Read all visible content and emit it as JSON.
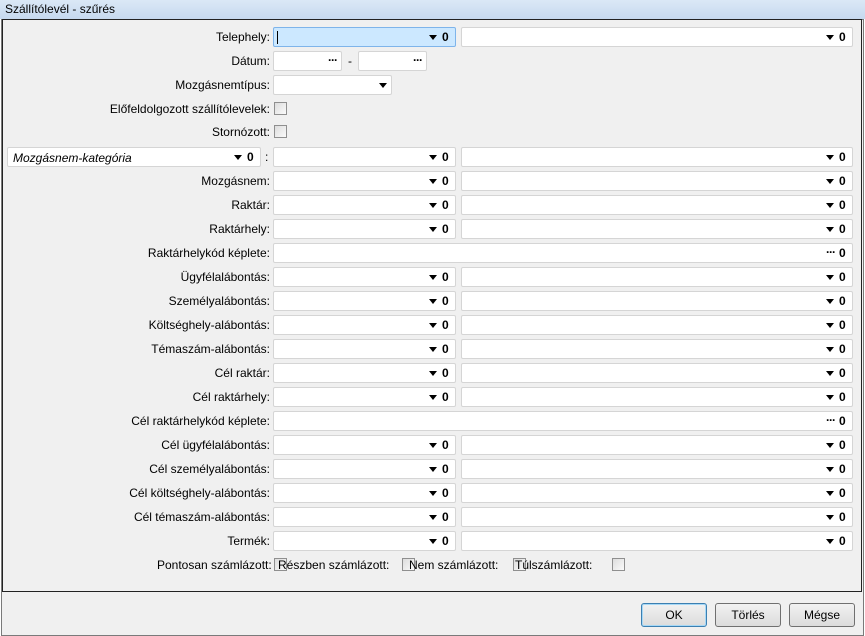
{
  "window": {
    "title": "Szállítólevél - szűrés"
  },
  "form": {
    "telephely": "Telephely:",
    "datum": "Dátum:",
    "datum_sep": "-",
    "mozgasnemtipus": "Mozgásnemtípus:",
    "elofeldolgozott": "Előfeldolgozott szállítólevelek:",
    "stornozott": "Stornózott:",
    "kategoria_select": "Mozgásnem-kategória",
    "kategoria_sep": ":",
    "pair_rows": [
      {
        "label": "Mozgásnem:",
        "type": "pair"
      },
      {
        "label": "Raktár:",
        "type": "pair"
      },
      {
        "label": "Raktárhely:",
        "type": "pair"
      },
      {
        "label": "Raktárhelykód képlete:",
        "type": "formula"
      },
      {
        "label": "Ügyfélalábontás:",
        "type": "pair"
      },
      {
        "label": "Személyalábontás:",
        "type": "pair"
      },
      {
        "label": "Költséghely-alábontás:",
        "type": "pair"
      },
      {
        "label": "Témaszám-alábontás:",
        "type": "pair"
      },
      {
        "label": "Cél raktár:",
        "type": "pair"
      },
      {
        "label": "Cél raktárhely:",
        "type": "pair"
      },
      {
        "label": "Cél raktárhelykód képlete:",
        "type": "formula"
      },
      {
        "label": "Cél ügyfélalábontás:",
        "type": "pair"
      },
      {
        "label": "Cél személyalábontás:",
        "type": "pair"
      },
      {
        "label": "Cél költséghely-alábontás:",
        "type": "pair"
      },
      {
        "label": "Cél témaszám-alábontás:",
        "type": "pair"
      },
      {
        "label": "Termék:",
        "type": "pair"
      }
    ],
    "invoice": [
      "Pontosan számlázott:",
      "Részben számlázott:",
      "Nem számlázott:",
      "Túlszámlázott:"
    ]
  },
  "buttons": {
    "ok": "OK",
    "torles": "Törlés",
    "megse": "Mégse"
  }
}
